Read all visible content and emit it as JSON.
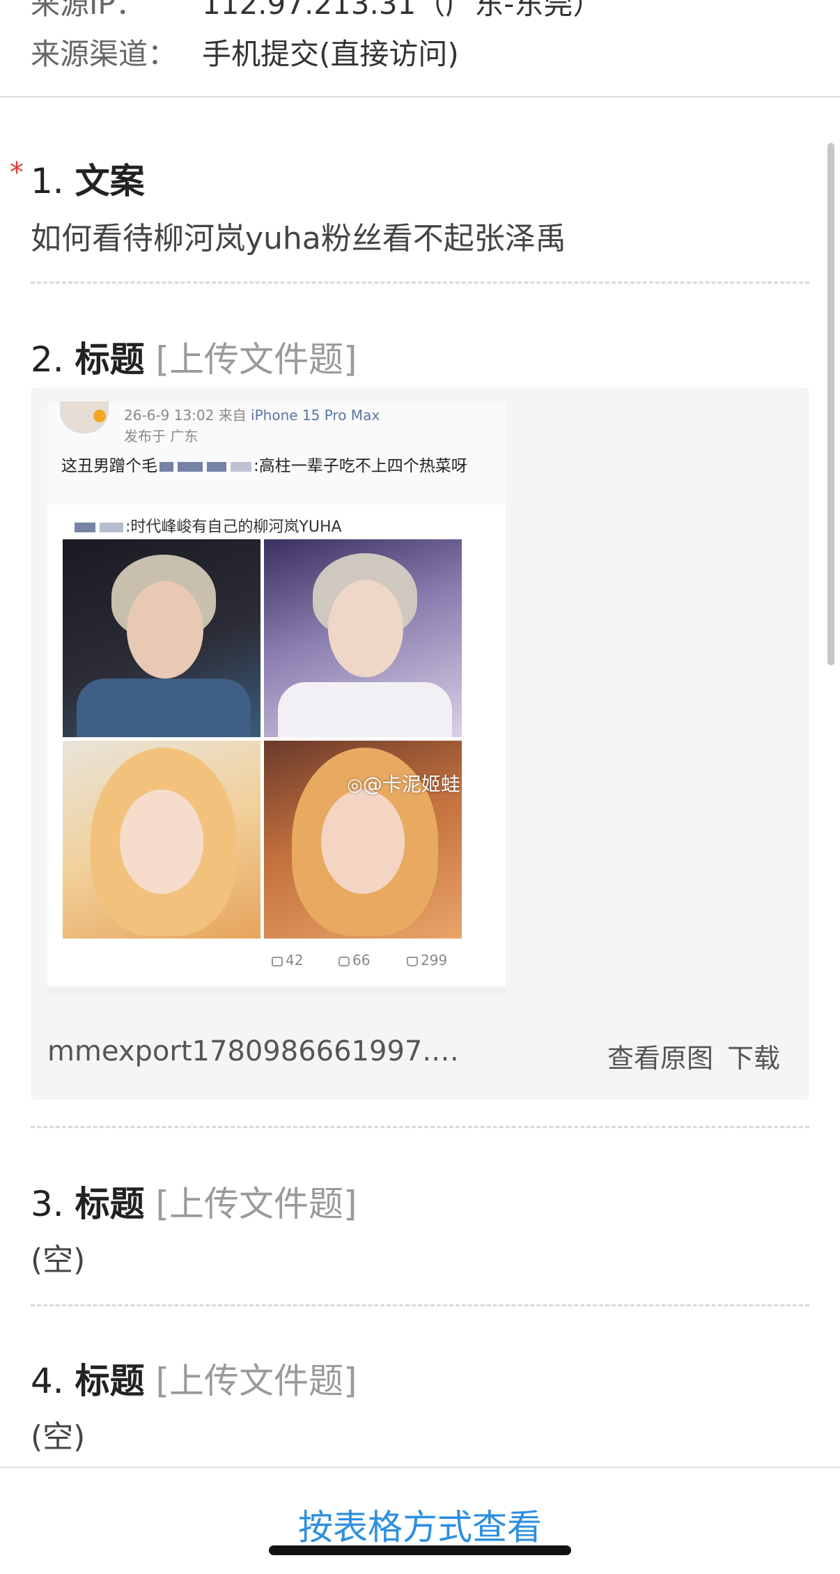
{
  "meta": {
    "ip_label": "来源IP：",
    "ip_value": "112.97.213.31（广东-东莞）",
    "channel_label": "来源渠道：",
    "channel_value": "手机提交(直接访问)"
  },
  "questions": [
    {
      "num": "1.",
      "title": "文案",
      "type": "",
      "required": "*",
      "answer": "如何看待柳河岚yuha粉丝看不起张泽禹"
    },
    {
      "num": "2.",
      "title": "标题",
      "type": "[上传文件题]"
    },
    {
      "num": "3.",
      "title": "标题",
      "type": "[上传文件题]",
      "answer": "(空)"
    },
    {
      "num": "4.",
      "title": "标题",
      "type": "[上传文件题]",
      "answer": "(空)"
    }
  ],
  "file": {
    "name": "mmexport1780986661997.…",
    "view_original": "查看原图",
    "download": "下载"
  },
  "post": {
    "time": "26-6-9 13:02",
    "from_prefix": "来自",
    "device": "iPhone 15 Pro Max",
    "location": "发布于 广东",
    "text_a": "这丑男蹭个毛",
    "text_b": ":高柱一辈子吃不上四个热菜呀",
    "repost": ":时代峰峻有自己的柳河岚YUHA",
    "watermark": "@卡泥姬蛙",
    "reposts": "42",
    "comments": "66",
    "likes": "299"
  },
  "footer": {
    "table_view": "按表格方式查看"
  },
  "colors": {
    "accent": "#2d8fe0",
    "required": "#e53935"
  }
}
